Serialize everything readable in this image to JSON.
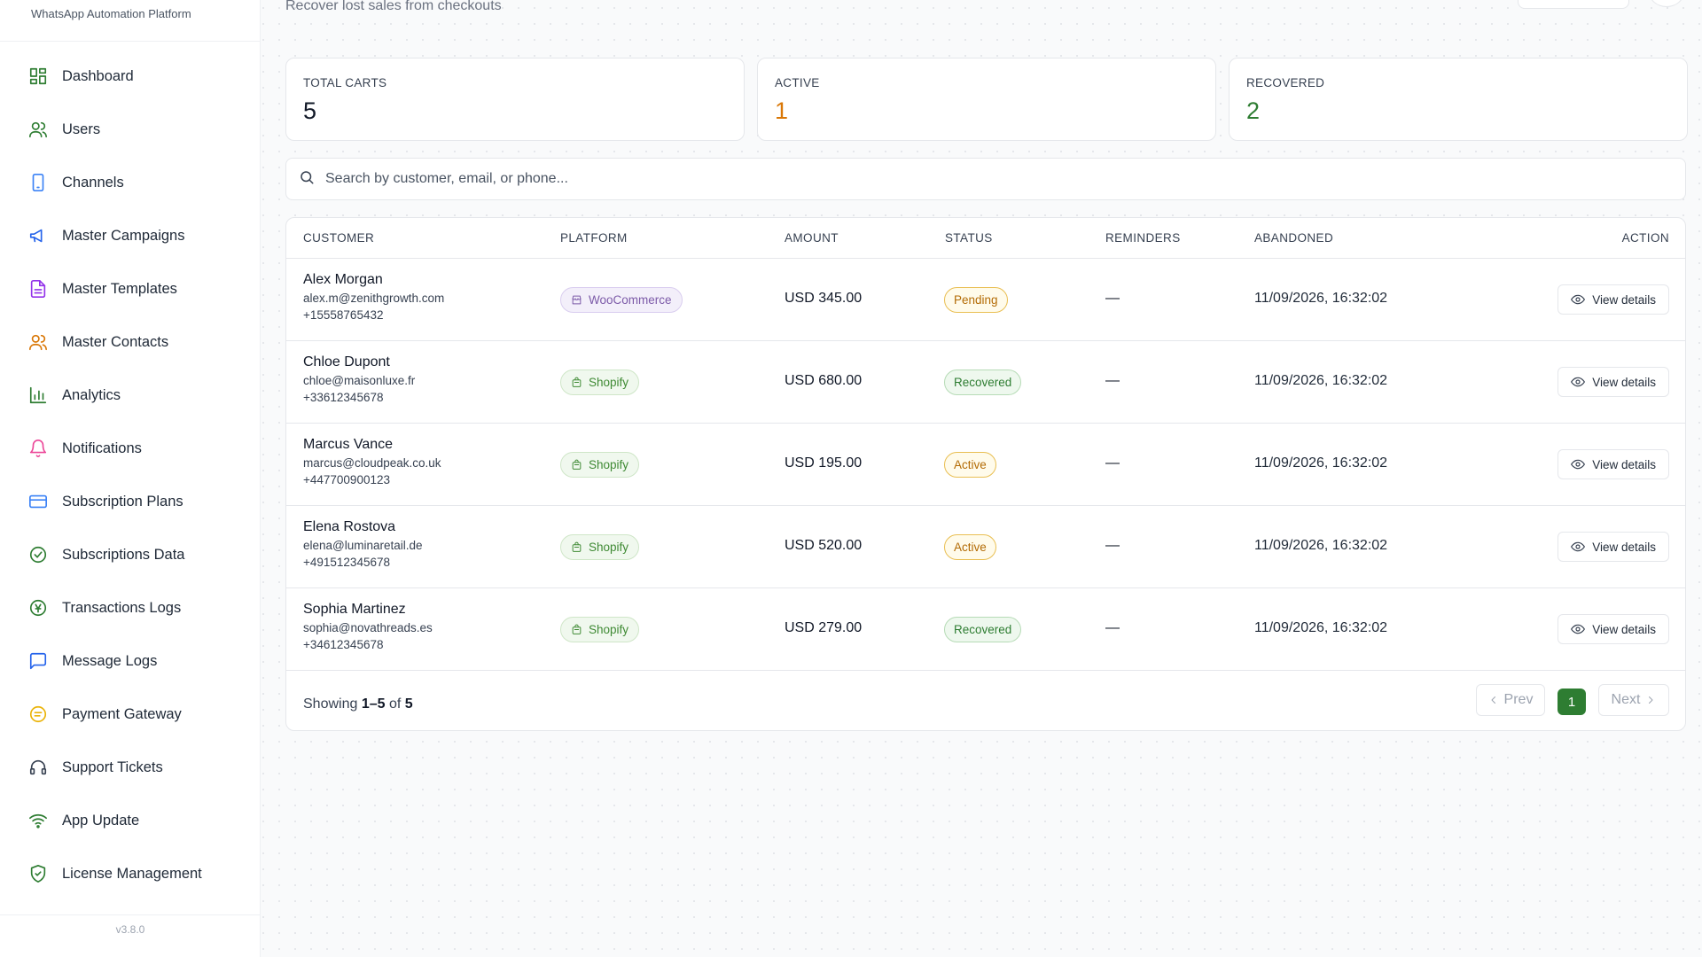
{
  "app": {
    "subtitle": "WhatsApp Automation Platform",
    "version": "v3.8.0"
  },
  "header": {
    "subtitle": "Recover lost sales from checkouts"
  },
  "sidebar": {
    "items": [
      {
        "label": "Dashboard",
        "icon": "dashboard-icon"
      },
      {
        "label": "Users",
        "icon": "users-icon"
      },
      {
        "label": "Channels",
        "icon": "phone-icon"
      },
      {
        "label": "Master Campaigns",
        "icon": "megaphone-icon"
      },
      {
        "label": "Master Templates",
        "icon": "file-text-icon"
      },
      {
        "label": "Master Contacts",
        "icon": "contacts-icon"
      },
      {
        "label": "Analytics",
        "icon": "bar-chart-icon"
      },
      {
        "label": "Notifications",
        "icon": "bell-icon"
      },
      {
        "label": "Subscription Plans",
        "icon": "credit-card-icon"
      },
      {
        "label": "Subscriptions Data",
        "icon": "check-circle-icon"
      },
      {
        "label": "Transactions Logs",
        "icon": "currency-icon"
      },
      {
        "label": "Message Logs",
        "icon": "message-icon"
      },
      {
        "label": "Payment Gateway",
        "icon": "gateway-icon"
      },
      {
        "label": "Support Tickets",
        "icon": "headset-icon"
      },
      {
        "label": "App Update",
        "icon": "wifi-icon"
      },
      {
        "label": "License Management",
        "icon": "shield-check-icon"
      }
    ]
  },
  "stats": {
    "total": {
      "label": "TOTAL CARTS",
      "value": "5",
      "color": "#111827"
    },
    "active": {
      "label": "ACTIVE",
      "value": "1",
      "color": "#d97706"
    },
    "recovered": {
      "label": "RECOVERED",
      "value": "2",
      "color": "#2e7d32"
    }
  },
  "search": {
    "placeholder": "Search by customer, email, or phone...",
    "value": ""
  },
  "table": {
    "columns": [
      "CUSTOMER",
      "PLATFORM",
      "AMOUNT",
      "STATUS",
      "REMINDERS",
      "ABANDONED",
      "ACTION"
    ],
    "rows": [
      {
        "name": "Alex Morgan",
        "email": "alex.m@zenithgrowth.com",
        "phone": "+15558765432",
        "platform": "WooCommerce",
        "amount": "USD 345.00",
        "status": "Pending",
        "reminders": "—",
        "abandoned": "11/09/2026, 16:32:02",
        "action": "View details"
      },
      {
        "name": "Chloe Dupont",
        "email": "chloe@maisonluxe.fr",
        "phone": "+33612345678",
        "platform": "Shopify",
        "amount": "USD 680.00",
        "status": "Recovered",
        "reminders": "—",
        "abandoned": "11/09/2026, 16:32:02",
        "action": "View details"
      },
      {
        "name": "Marcus Vance",
        "email": "marcus@cloudpeak.co.uk",
        "phone": "+447700900123",
        "platform": "Shopify",
        "amount": "USD 195.00",
        "status": "Active",
        "reminders": "—",
        "abandoned": "11/09/2026, 16:32:02",
        "action": "View details"
      },
      {
        "name": "Elena Rostova",
        "email": "elena@luminaretail.de",
        "phone": "+491512345678",
        "platform": "Shopify",
        "amount": "USD 520.00",
        "status": "Active",
        "reminders": "—",
        "abandoned": "11/09/2026, 16:32:02",
        "action": "View details"
      },
      {
        "name": "Sophia Martinez",
        "email": "sophia@novathreads.es",
        "phone": "+34612345678",
        "platform": "Shopify",
        "amount": "USD 279.00",
        "status": "Recovered",
        "reminders": "—",
        "abandoned": "11/09/2026, 16:32:02",
        "action": "View details"
      }
    ]
  },
  "footer": {
    "showing_prefix": "Showing ",
    "showing_range": "1–5",
    "showing_of": " of ",
    "showing_total": "5",
    "prev": "Prev",
    "next": "Next",
    "current_page": "1"
  },
  "colors": {
    "accent": "#2e7d32",
    "warning": "#d97706",
    "woo": "#7c5aa8",
    "shopify": "#3f8a34"
  }
}
